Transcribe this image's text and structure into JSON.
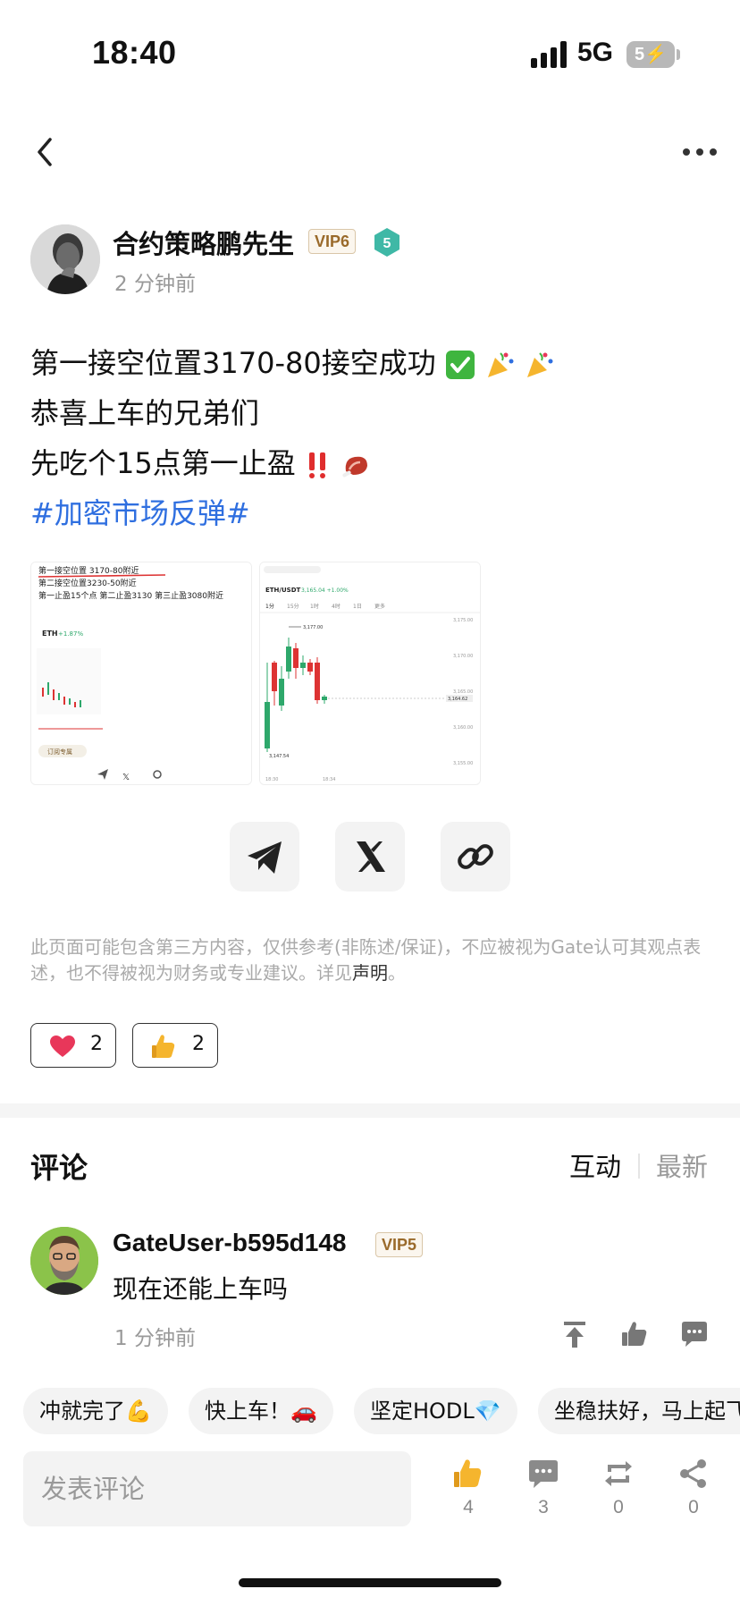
{
  "status_bar": {
    "time": "18:40",
    "network": "5G",
    "battery": "5"
  },
  "author": {
    "name": "合约策略鹏先生",
    "vip": "VIP6",
    "level": "5",
    "time": "2 分钟前"
  },
  "post": {
    "line1": "第一接空位置3170-80接空成功",
    "line2": "恭喜上车的兄弟们",
    "line3": "先吃个15点第一止盈",
    "hashtag": "#加密市场反弹#"
  },
  "image_a": {
    "line1": "第一接空位置 3170-80附近",
    "line2": "第二接空位置3230-50附近",
    "line3": "第一止盈15个点 第二止盈3130 第三止盈3080附近",
    "ticker": "ETH",
    "change": "+1.87%",
    "tag": "订阅专属"
  },
  "image_b": {
    "pair": "ETH/USDT",
    "price": "3,165.04 +1.00%",
    "tabs": [
      "1分",
      "15分",
      "1时",
      "4时",
      "1日",
      "更多"
    ],
    "high": "3,177.00",
    "low": "3,147.54",
    "last": "3,164.62",
    "y_ticks": [
      "3,175.00",
      "3,170.00",
      "3,165.00",
      "3,160.00",
      "3,155.00"
    ],
    "x_ticks": [
      "18:30",
      "18:34"
    ]
  },
  "disclaimer": {
    "text": "此页面可能包含第三方内容，仅供参考(非陈述/保证)，不应被视为Gate认可其观点表述，也不得被视为财务或专业建议。详见",
    "link": "声明",
    "end": "。"
  },
  "reactions": [
    {
      "icon": "heart-icon",
      "count": "2"
    },
    {
      "icon": "thumbs-up-emoji",
      "count": "2"
    }
  ],
  "comments": {
    "title": "评论",
    "sort_hot": "互动",
    "sort_new": "最新",
    "items": [
      {
        "user": "GateUser-b595d148",
        "vip": "VIP5",
        "text": "现在还能上车吗",
        "time": "1 分钟前"
      }
    ]
  },
  "quick_replies": [
    "冲就完了💪",
    "快上车！🚗",
    "坚定HODL💎",
    "坐稳扶好，马上起飞"
  ],
  "composer": {
    "placeholder": "发表评论"
  },
  "actions": {
    "like_count": "4",
    "comment_count": "3",
    "repost_count": "0",
    "share_count": "0"
  },
  "colors": {
    "hashtag": "#2f6fe0",
    "heart": "#e8375a",
    "vip_text": "#9a6a2b",
    "level_badge": "#3fb8a6"
  }
}
